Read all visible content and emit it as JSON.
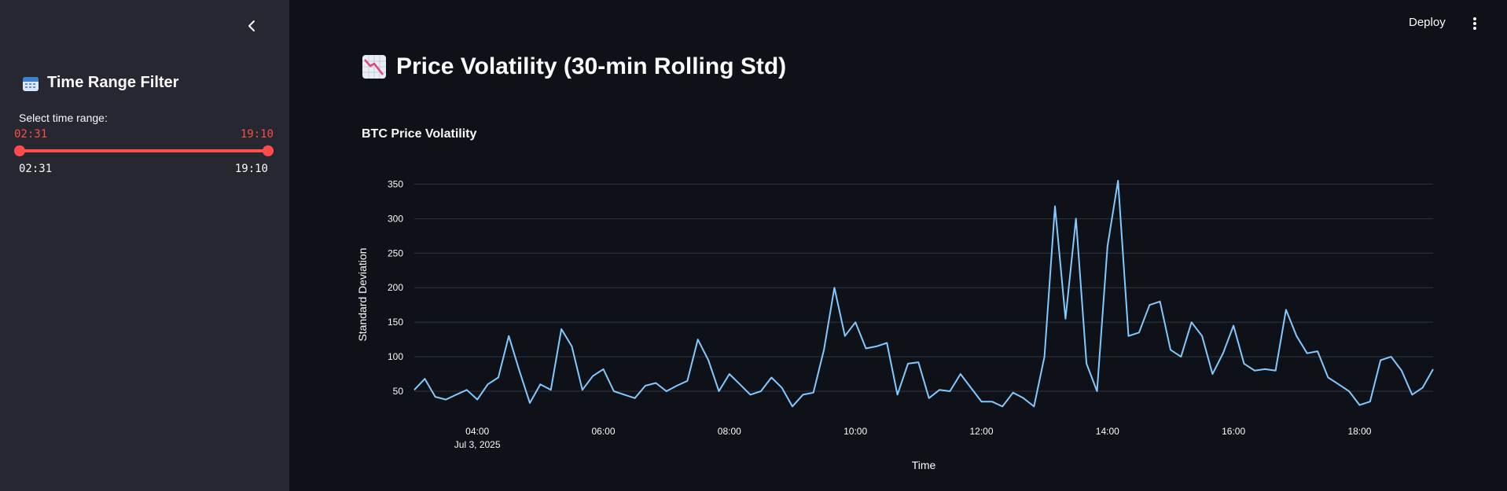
{
  "sidebar": {
    "title": "Time Range Filter",
    "slider_label": "Select time range:",
    "slider_value_start": "02:31",
    "slider_value_end": "19:10",
    "slider_min": "02:31",
    "slider_max": "19:10",
    "accent": "#ff4b4b"
  },
  "header": {
    "deploy_label": "Deploy"
  },
  "main": {
    "page_title": "Price Volatility (30-min Rolling Std)"
  },
  "chart_data": {
    "type": "line",
    "title": "BTC Price Volatility",
    "xlabel": "Time",
    "ylabel": "Standard Deviation",
    "x_ticks": [
      "04:00",
      "06:00",
      "08:00",
      "10:00",
      "12:00",
      "14:00",
      "16:00",
      "18:00"
    ],
    "x_tick_sublabel": "Jul 3, 2025",
    "y_ticks": [
      50,
      100,
      150,
      200,
      250,
      300,
      350
    ],
    "xlim": [
      "03:00",
      "19:10"
    ],
    "ylim": [
      25,
      355
    ],
    "grid": true,
    "line_color": "#83c9ff",
    "series": [
      {
        "x": [
          "03:00",
          "03:10",
          "03:20",
          "03:30",
          "03:40",
          "03:50",
          "04:00",
          "04:10",
          "04:20",
          "04:30",
          "04:40",
          "04:50",
          "05:00",
          "05:10",
          "05:20",
          "05:30",
          "05:40",
          "05:50",
          "06:00",
          "06:10",
          "06:20",
          "06:30",
          "06:40",
          "06:50",
          "07:00",
          "07:10",
          "07:20",
          "07:30",
          "07:40",
          "07:50",
          "08:00",
          "08:10",
          "08:20",
          "08:30",
          "08:40",
          "08:50",
          "09:00",
          "09:10",
          "09:20",
          "09:30",
          "09:40",
          "09:50",
          "10:00",
          "10:10",
          "10:20",
          "10:30",
          "10:40",
          "10:50",
          "11:00",
          "11:10",
          "11:20",
          "11:30",
          "11:40",
          "11:50",
          "12:00",
          "12:10",
          "12:20",
          "12:30",
          "12:40",
          "12:50",
          "13:00",
          "13:10",
          "13:20",
          "13:30",
          "13:40",
          "13:50",
          "14:00",
          "14:10",
          "14:20",
          "14:30",
          "14:40",
          "14:50",
          "15:00",
          "15:10",
          "15:20",
          "15:30",
          "15:40",
          "15:50",
          "16:00",
          "16:10",
          "16:20",
          "16:30",
          "16:40",
          "16:50",
          "17:00",
          "17:10",
          "17:20",
          "17:30",
          "17:40",
          "17:50",
          "18:00",
          "18:10",
          "18:20",
          "18:30",
          "18:40",
          "18:50",
          "19:00",
          "19:10"
        ],
        "values": [
          52,
          68,
          42,
          38,
          45,
          52,
          38,
          60,
          70,
          130,
          80,
          33,
          60,
          52,
          140,
          115,
          52,
          72,
          82,
          50,
          45,
          40,
          58,
          62,
          50,
          58,
          65,
          125,
          95,
          50,
          75,
          60,
          45,
          50,
          70,
          55,
          28,
          45,
          48,
          110,
          200,
          130,
          150,
          112,
          115,
          120,
          45,
          90,
          92,
          40,
          52,
          50,
          75,
          55,
          35,
          35,
          28,
          48,
          40,
          28,
          100,
          318,
          155,
          300,
          90,
          50,
          260,
          355,
          130,
          135,
          175,
          180,
          110,
          100,
          150,
          130,
          75,
          105,
          145,
          90,
          80,
          82,
          80,
          168,
          130,
          105,
          108,
          70,
          60,
          50,
          30,
          35,
          95,
          100,
          80,
          45,
          55,
          82
        ]
      }
    ]
  }
}
